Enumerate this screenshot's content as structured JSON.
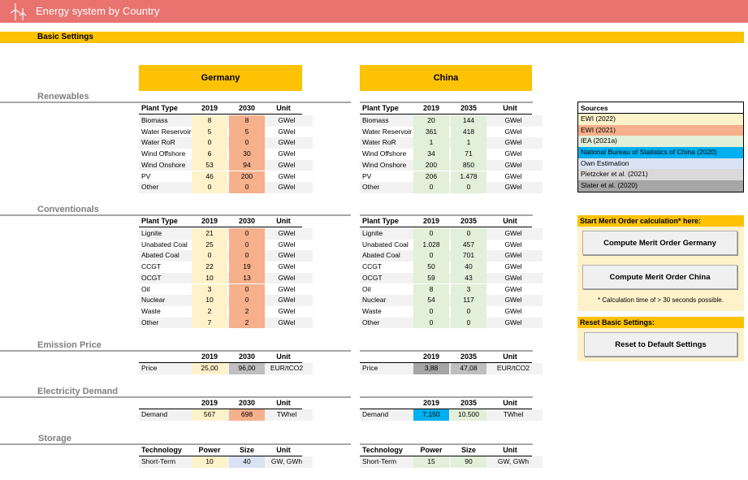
{
  "header": {
    "title": "Energy system by Country",
    "logo": "wind-turbine-icon"
  },
  "settings": {
    "label": "Basic Settings"
  },
  "countries": {
    "left": "Germany",
    "right": "China"
  },
  "renewables": {
    "title": "Renewables",
    "left": {
      "headers": [
        "Plant Type",
        "2019",
        "2030",
        "Unit"
      ],
      "rows": [
        [
          "Biomass",
          "8",
          "8",
          "GWel"
        ],
        [
          "Water Reservoir",
          "5",
          "5",
          "GWel"
        ],
        [
          "Water RoR",
          "0",
          "0",
          "GWel"
        ],
        [
          "Wind Offshore",
          "6",
          "30",
          "GWel"
        ],
        [
          "Wind Onshore",
          "53",
          "94",
          "GWel"
        ],
        [
          "PV",
          "46",
          "200",
          "GWel"
        ],
        [
          "Other",
          "0",
          "0",
          "GWel"
        ]
      ]
    },
    "right": {
      "headers": [
        "Plant Type",
        "2019",
        "2035",
        "Unit"
      ],
      "rows": [
        [
          "Biomass",
          "20",
          "144",
          "GWel"
        ],
        [
          "Water Reservoir",
          "361",
          "418",
          "GWel"
        ],
        [
          "Water RoR",
          "1",
          "1",
          "GWel"
        ],
        [
          "Wind Offshore",
          "34",
          "71",
          "GWel"
        ],
        [
          "Wind Onshore",
          "200",
          "850",
          "GWel"
        ],
        [
          "PV",
          "206",
          "1.478",
          "GWel"
        ],
        [
          "Other",
          "0",
          "0",
          "GWel"
        ]
      ]
    }
  },
  "conventionals": {
    "title": "Conventionals",
    "left": {
      "headers": [
        "Plant Type",
        "2019",
        "2030",
        "Unit"
      ],
      "rows": [
        [
          "Lignite",
          "21",
          "0",
          "GWel"
        ],
        [
          "Unabated Coal",
          "25",
          "0",
          "GWel"
        ],
        [
          "Abated Coal",
          "0",
          "0",
          "GWel"
        ],
        [
          "CCGT",
          "22",
          "19",
          "GWel"
        ],
        [
          "OCGT",
          "10",
          "13",
          "GWel"
        ],
        [
          "Oil",
          "3",
          "0",
          "GWel"
        ],
        [
          "Nuclear",
          "10",
          "0",
          "GWel"
        ],
        [
          "Waste",
          "2",
          "2",
          "GWel"
        ],
        [
          "Other",
          "7",
          "2",
          "GWel"
        ]
      ]
    },
    "right": {
      "headers": [
        "Plant Type",
        "2019",
        "2035",
        "Unit"
      ],
      "rows": [
        [
          "Lignite",
          "0",
          "0",
          "GWel"
        ],
        [
          "Unabated Coal",
          "1.028",
          "457",
          "GWel"
        ],
        [
          "Abated Coal",
          "0",
          "701",
          "GWel"
        ],
        [
          "CCGT",
          "50",
          "40",
          "GWel"
        ],
        [
          "OCGT",
          "59",
          "43",
          "GWel"
        ],
        [
          "Oil",
          "8",
          "3",
          "GWel"
        ],
        [
          "Nuclear",
          "54",
          "117",
          "GWel"
        ],
        [
          "Waste",
          "0",
          "0",
          "GWel"
        ],
        [
          "Other",
          "0",
          "0",
          "GWel"
        ]
      ]
    }
  },
  "emission": {
    "title": "Emission Price",
    "left": {
      "headers": [
        "",
        "2019",
        "2030",
        "Unit"
      ],
      "rows": [
        [
          "Price",
          "25,00",
          "96,00",
          "EUR/tCO2"
        ]
      ]
    },
    "right": {
      "headers": [
        "",
        "2019",
        "2035",
        "Unit"
      ],
      "rows": [
        [
          "Price",
          "3,88",
          "47,08",
          "EUR/tCO2"
        ]
      ]
    }
  },
  "demand": {
    "title": "Electricity Demand",
    "left": {
      "headers": [
        "",
        "2019",
        "2030",
        "Unit"
      ],
      "rows": [
        [
          "Demand",
          "567",
          "698",
          "TWhel"
        ]
      ]
    },
    "right": {
      "headers": [
        "",
        "2019",
        "2035",
        "Unit"
      ],
      "rows": [
        [
          "Demand",
          "7.150",
          "10.500",
          "TWhel"
        ]
      ]
    }
  },
  "storage": {
    "title": "Storage",
    "left": {
      "headers": [
        "Technology",
        "Power",
        "Size",
        "Unit"
      ],
      "rows": [
        [
          "Short-Term",
          "10",
          "40",
          "GW, GWh"
        ]
      ]
    },
    "right": {
      "headers": [
        "Technology",
        "Power",
        "Size",
        "Unit"
      ],
      "rows": [
        [
          "Short-Term",
          "15",
          "90",
          "GW, GWh"
        ]
      ]
    }
  },
  "sources": {
    "title": "Sources",
    "items": [
      {
        "label": "EWI (2022)",
        "color": "#fef2cb"
      },
      {
        "label": "EWI (2021)",
        "color": "#f6b08c"
      },
      {
        "label": "IEA (2021a)",
        "color": "#e2efd9"
      },
      {
        "label": "National Bureau of Statistics of China (2020)",
        "color": "#00b0f0"
      },
      {
        "label": "Own Estimation",
        "color": "#dae3f3"
      },
      {
        "label": "Pietzcker et al. (2021)",
        "color": "#d9d9d9"
      },
      {
        "label": "Slater et al. (2020)",
        "color": "#a6a6a6"
      }
    ]
  },
  "merit": {
    "title": "Start Merit Order calculation* here:",
    "germany_button": "Compute Merit Order Germany",
    "china_button": "Compute Merit Order China",
    "note": "* Calculation time of > 30 seconds possible."
  },
  "reset": {
    "title": "Reset Basic Settings:",
    "button": "Reset to Default Settings"
  },
  "colors": {
    "header": "#e8736f",
    "accent": "#fdc203"
  }
}
